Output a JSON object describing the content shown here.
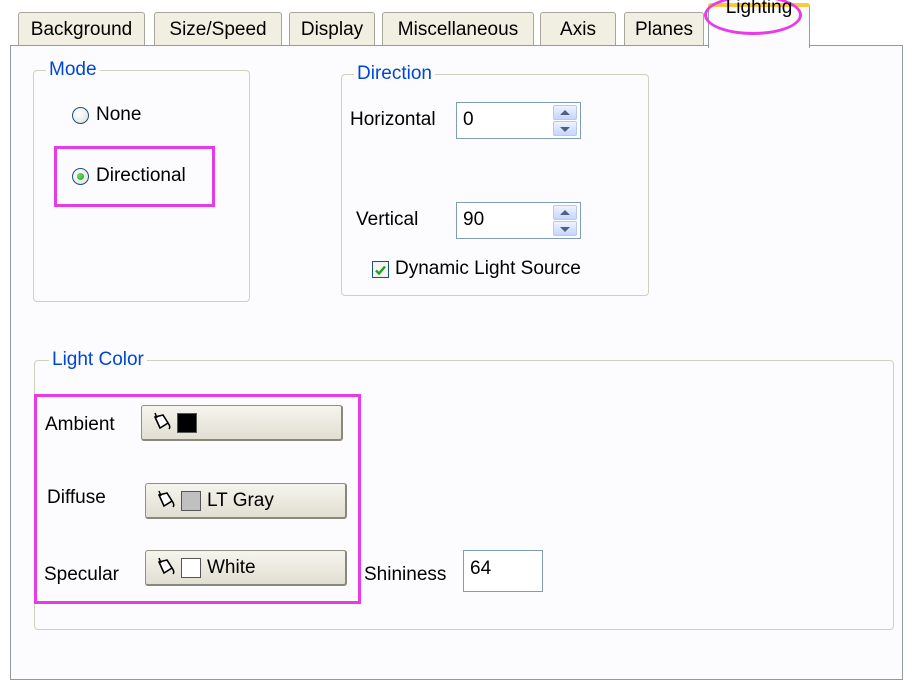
{
  "tabs": [
    {
      "label": "Background"
    },
    {
      "label": "Size/Speed"
    },
    {
      "label": "Display"
    },
    {
      "label": "Miscellaneous"
    },
    {
      "label": "Axis"
    },
    {
      "label": "Planes"
    },
    {
      "label": "Lighting",
      "active": true
    }
  ],
  "mode": {
    "title": "Mode",
    "options": [
      {
        "label": "None",
        "selected": false
      },
      {
        "label": "Directional",
        "selected": true
      }
    ]
  },
  "direction": {
    "title": "Direction",
    "horizontal_label": "Horizontal",
    "horizontal_value": "0",
    "vertical_label": "Vertical",
    "vertical_value": "90",
    "dynamic_label": "Dynamic Light Source",
    "dynamic_checked": true
  },
  "light_color": {
    "title": "Light Color",
    "ambient": {
      "label": "Ambient",
      "color_name": "",
      "color": "#000000"
    },
    "diffuse": {
      "label": "Diffuse",
      "color_name": "LT Gray",
      "color": "#c0c0c0"
    },
    "specular": {
      "label": "Specular",
      "color_name": "White",
      "color": "#ffffff"
    },
    "shininess_label": "Shininess",
    "shininess_value": "64"
  },
  "icons": {
    "paint_bucket": "paint-bucket-icon"
  },
  "highlight_color": "#e83ae8"
}
